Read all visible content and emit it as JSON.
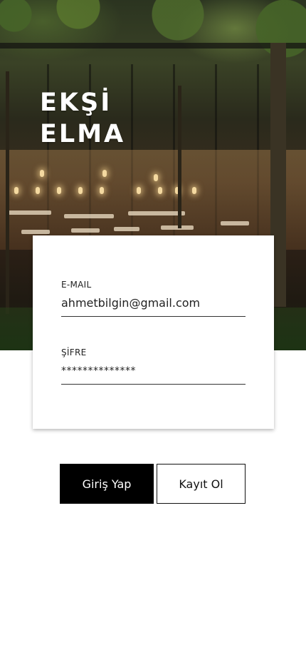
{
  "brand": {
    "line1": "EKŞİ",
    "line2": "ELMA"
  },
  "login_form": {
    "email": {
      "label": "E-MAIL",
      "value": "ahmetbilgin@gmail.com"
    },
    "password": {
      "label": "ŞİFRE",
      "value": "**************"
    }
  },
  "actions": {
    "login_label": "Giriş Yap",
    "register_label": "Kayıt Ol"
  },
  "colors": {
    "primary_button_bg": "#000000",
    "primary_button_text": "#ffffff",
    "secondary_button_border": "#111111"
  }
}
